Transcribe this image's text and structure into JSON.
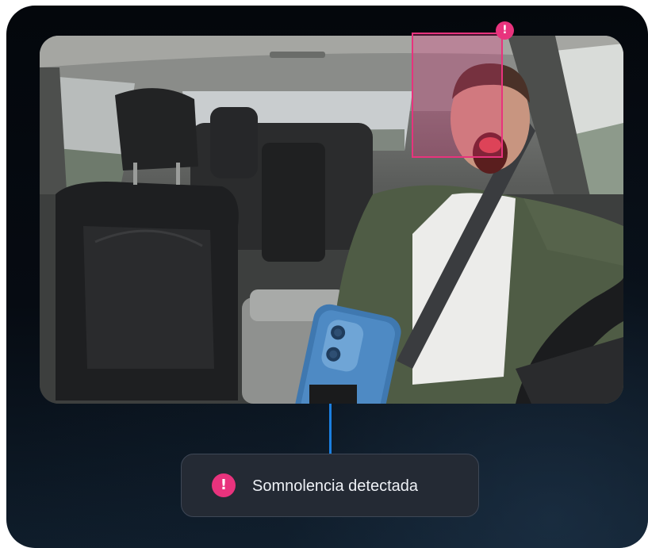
{
  "camera": {
    "description_icon": "in-cabin-driver-camera",
    "detection": {
      "alert_glyph": "!",
      "color": "#e8337d"
    }
  },
  "alert": {
    "icon_glyph": "!",
    "message": "Somnolencia detectada",
    "accent_color": "#e8337d",
    "connector_color": "#1b7fe0"
  }
}
